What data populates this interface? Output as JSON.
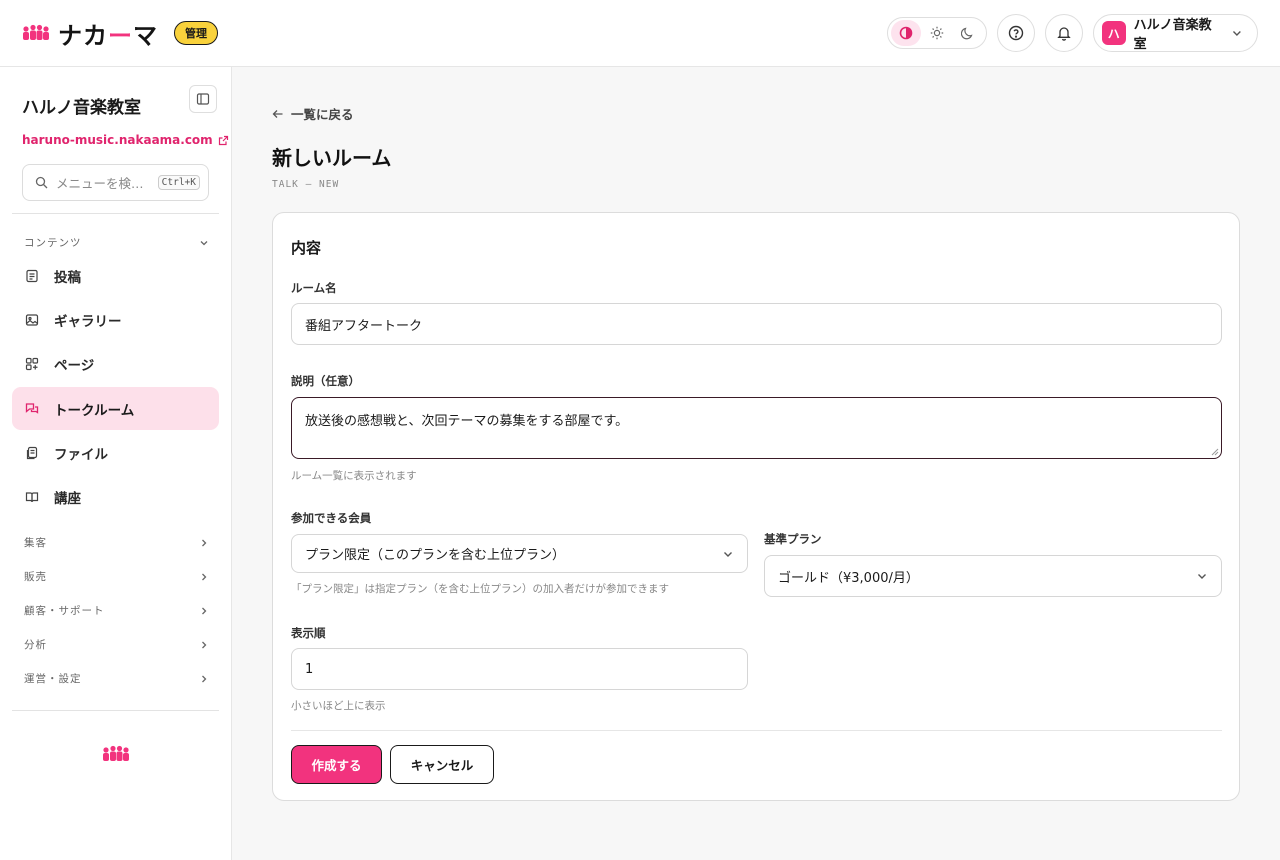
{
  "header": {
    "logo_text_a": "ナカ",
    "logo_text_b": "ー",
    "logo_text_c": "マ",
    "admin_badge": "管理",
    "account_initial": "ハ",
    "account_name": "ハルノ音楽教室"
  },
  "sidebar": {
    "site_name": "ハルノ音楽教室",
    "site_url": "haruno-music.nakaama.com",
    "search_placeholder": "メニューを検…",
    "search_shortcut": "Ctrl+K",
    "content_group": "コンテンツ",
    "items": [
      {
        "label": "投稿",
        "icon": "document-icon"
      },
      {
        "label": "ギャラリー",
        "icon": "image-icon"
      },
      {
        "label": "ページ",
        "icon": "page-grid-icon"
      },
      {
        "label": "トークルーム",
        "icon": "chat-icon"
      },
      {
        "label": "ファイル",
        "icon": "files-icon"
      },
      {
        "label": "講座",
        "icon": "book-icon"
      }
    ],
    "active_item": "トークルーム",
    "groups": [
      "集客",
      "販売",
      "顧客・サポート",
      "分析",
      "運営・設定"
    ]
  },
  "main": {
    "back_label": "一覧に戻る",
    "title": "新しいルーム",
    "subtitle": "TALK — NEW",
    "card_title": "内容",
    "room_name_label": "ルーム名",
    "room_name_value": "番組アフタートーク",
    "description_label": "説明（任意）",
    "description_value": "放送後の感想戦と、次回テーマの募集をする部屋です。",
    "description_hint": "ルーム一覧に表示されます",
    "members_label": "参加できる会員",
    "members_value": "プラン限定（このプランを含む上位プラン）",
    "members_hint": "「プラン限定」は指定プラン（を含む上位プラン）の加入者だけが参加できます",
    "base_plan_label": "基準プラン",
    "base_plan_value": "ゴールド（¥3,000/月）",
    "order_label": "表示順",
    "order_value": "1",
    "order_hint": "小さいほど上に表示",
    "create_button": "作成する",
    "cancel_button": "キャンセル"
  },
  "colors": {
    "accent": "#f2337e",
    "badge": "#f9d23c",
    "active_nav_bg": "#fde0ea"
  }
}
